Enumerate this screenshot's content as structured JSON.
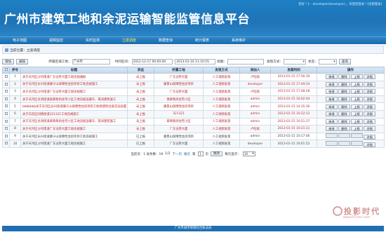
{
  "header": {
    "title": "广州市建筑工地和余泥运输智能监管信息平台",
    "user_info": "您好 ! 1 - developer(developer) 。欢迎您登录 ! [注销登录]"
  },
  "nav": {
    "items": [
      {
        "label": "电子地图"
      },
      {
        "label": "视频监控"
      },
      {
        "label": "实时监测"
      },
      {
        "label": "立案调度"
      },
      {
        "label": "数据查询"
      },
      {
        "label": "统计报表"
      },
      {
        "label": "系统维护"
      }
    ],
    "active_index": 3
  },
  "breadcrumb": {
    "text": "当前位置：立案调度"
  },
  "toolbar": {
    "add_label": "增加",
    "delete_label": "删除",
    "site_label": "所属区域工地：",
    "site_value": "广州市",
    "time_label": "时间区间：",
    "time_start": "2012-12-17 00:00:00",
    "time_sep": "-",
    "time_end": "2013-01-16 11:10:55",
    "title_label": "标题：",
    "title_value": "",
    "find_label": "发现方式：",
    "find_value": "",
    "status_label": "状态：",
    "status_value": "",
    "query_label": "查询"
  },
  "table": {
    "headers": [
      "序号",
      "标题",
      "状态",
      "所属工地",
      "发现方式",
      "添加人",
      "发案时间",
      "操作"
    ],
    "rows": [
      {
        "no": "1",
        "title": "关于天河区沙河南道广东证券大厦工地违规通报",
        "status": "未上报",
        "site": "广东证券大厦",
        "method": "人工视频发现",
        "adder": "卢旺雨",
        "time": "2013-01-15 17:56:39",
        "ops": [
          "修改",
          "删除",
          "上报",
          "详细"
        ],
        "red": true
      },
      {
        "no": "2",
        "title": "关于天河区长兴街道康宁山保障性住房项目工地违规施工",
        "status": "未上报",
        "site": "康景山保障性住房项目",
        "method": "人工视频发现",
        "adder": "developer",
        "time": "2013-01-15 17:49:24",
        "ops": [
          "修改",
          "删除",
          "上报",
          "详细"
        ],
        "red": true
      },
      {
        "no": "3",
        "title": "关于天河区沙河南道广东证券大厦工地违规施工",
        "status": "未上报",
        "site": "广东证券大厦",
        "method": "人工视频发现",
        "adder": "卢旺雨",
        "time": "2013-01-15 17:48:28",
        "ops": [
          "修改",
          "删除",
          "上报",
          "详细"
        ],
        "red": true
      },
      {
        "no": "4",
        "title": "关于天河区龙洞街道国翠翡尚住宅小区工地违规运输车、夜间建筑施工",
        "status": "未上报",
        "site": "翡翠翡尚住宅小区",
        "method": "人工视频发现",
        "adder": "admin",
        "time": "2013-01-15 16:02:04",
        "ops": [
          "修改",
          "删除",
          "上报",
          "详细"
        ],
        "red": true
      },
      {
        "no": "5",
        "title": "bbbbbbb关于天河区长兴街道康宁山保障性住房项目工地将建筑垃圾违法处置",
        "status": "未上报",
        "site": "康景山保障性住房项目",
        "method": "人工视频发现",
        "adder": "admin",
        "time": "2013-01-15 14:35:30",
        "ops": [
          "修改",
          "删除",
          "上报",
          "详细"
        ],
        "red": true
      },
      {
        "no": "6",
        "title": "关于白云区同德街道321321工地违规施工",
        "status": "未上报",
        "site": "321321",
        "method": "人工视频发现",
        "adder": "admin",
        "time": "2013-01-15 10:22:13",
        "ops": [
          "修改",
          "删除",
          "上报",
          "详细"
        ],
        "red": true
      },
      {
        "no": "7",
        "title": "关于天河区龙洞街道翠翡翡尚住宅小区工地违规运输车、夜间建筑施工",
        "status": "未上报",
        "site": "翠翡翡尚住宅小区",
        "method": "人工视频发现",
        "adder": "admin",
        "time": "2013-01-15 10:21:37",
        "ops": [
          "修改",
          "删除",
          "上报",
          "详细"
        ],
        "red": true
      },
      {
        "no": "8",
        "title": "关于天河区沙河南道广东证券大厦工地违规施工",
        "status": "未上报",
        "site": "广东证券大厦",
        "method": "人工视频发现",
        "adder": "卢旺雨",
        "time": "2013-01-15 10:21:11",
        "ops": [
          "修改",
          "删除",
          "上报",
          "详细"
        ],
        "red": true
      },
      {
        "no": "9",
        "title": "关于天河区长兴街道康宁山保障性住房项目工地违规施工",
        "status": "已上报",
        "site": "康景山保障性住房项目",
        "method": "人工视频发现",
        "adder": "admin",
        "time": "2013-01-15 10:17:46",
        "ops": [
          "",
          "",
          "",
          "详细"
        ],
        "red": false
      },
      {
        "no": "10",
        "title": "关于天河区沙河南道广东证券大厦工地违规施工",
        "status": "已上报",
        "site": "广东证券大厦",
        "method": "人工视频发现",
        "adder": "developer",
        "time": "2013-01-15 10:01:52",
        "ops": [
          "",
          "",
          "",
          "详细"
        ],
        "red": false
      }
    ]
  },
  "pager": {
    "summary": "当前页：1  总条数：19",
    "page_of": "1/2",
    "next": "下一页",
    "last": "尾页",
    "goto_prefix": "第",
    "goto_value": "1",
    "goto_suffix": "页",
    "jump": "跳转",
    "per_page_label": "每页显示：",
    "per_page_value": "10"
  },
  "footer": {
    "text": "广州市城市管理综合执法局"
  },
  "watermark": {
    "text": "投影时代",
    "url": "www.PjTime.com"
  },
  "colors": {
    "header_blue": "#1f73b6",
    "alert_red": "#c0272d",
    "active_nav": "#ffe066"
  }
}
